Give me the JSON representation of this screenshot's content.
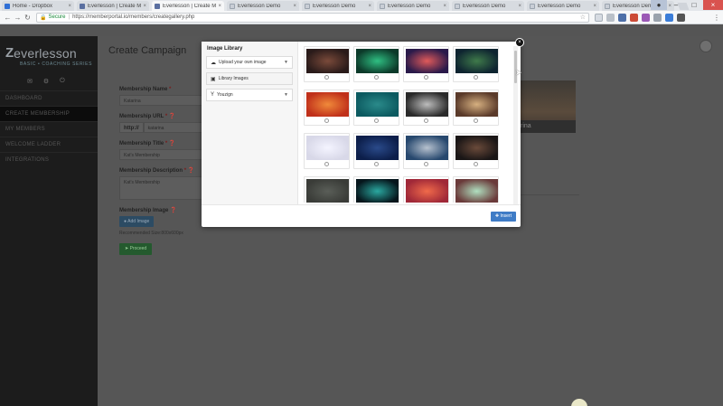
{
  "browser": {
    "tabs": [
      {
        "title": "Home - Dropbox",
        "icon": "dropbox-icon",
        "active": false
      },
      {
        "title": "Everlesson | Create Me",
        "icon": "everlesson-icon",
        "active": false
      },
      {
        "title": "Everlesson | Create M",
        "icon": "everlesson-icon",
        "active": true
      },
      {
        "title": "Everlesson Demo",
        "icon": "page-icon",
        "active": false
      },
      {
        "title": "Everlesson Demo",
        "icon": "page-icon",
        "active": false
      },
      {
        "title": "Everlesson Demo",
        "icon": "page-icon",
        "active": false
      },
      {
        "title": "Everlesson Demo",
        "icon": "page-icon",
        "active": false
      },
      {
        "title": "Everlesson Demo",
        "icon": "page-icon",
        "active": false
      },
      {
        "title": "Everlesson Demo",
        "icon": "page-icon",
        "active": false
      }
    ],
    "secure_label": "Secure",
    "url": "https://memberportal.io/members/creategallery.php"
  },
  "app": {
    "logo_word": "everlesson",
    "logo_tag": "BASIC • COACHING SERIES",
    "sidebar_items": [
      "Dashboard",
      "Create Membership",
      "My Members",
      "Welcome Ladder",
      "Integrations"
    ],
    "page_title": "Create Campaign",
    "form": {
      "name_label": "Membership Name",
      "name_value": "Katarina",
      "url_label": "Membership URL",
      "url_prefix": "http://",
      "url_value": "katarina",
      "title_label": "Membership Title",
      "title_value": "Kat's Membership",
      "desc_label": "Membership Description",
      "desc_value": "Kat's Membership",
      "image_label": "Membership Image",
      "add_image_label": "Add Image",
      "hint": "Recommended Size:800x600px",
      "proceed_label": "Proceed"
    },
    "preview_caption": "rina"
  },
  "modal": {
    "title": "Image Library",
    "upload_label": "Upload your own image",
    "library_label": "Library Images",
    "filter_label": "Youzign",
    "insert_label": "Insert",
    "thumb_colors": [
      [
        "#2a1b1a",
        "#7a4a3a"
      ],
      [
        "#0c3a2a",
        "#2fbf82"
      ],
      [
        "#2a1a4a",
        "#e05a5a"
      ],
      [
        "#0e2430",
        "#3f7a4a"
      ],
      [
        "#c0301a",
        "#f08a3a"
      ],
      [
        "#0c5a60",
        "#2a8a8a"
      ],
      [
        "#2a2a2a",
        "#bdbdbd"
      ],
      [
        "#5a3a2a",
        "#d6b080"
      ],
      [
        "#d8d8e8",
        "#f4f4ff"
      ],
      [
        "#0c1e4a",
        "#2a4a8a"
      ],
      [
        "#27486e",
        "#b7c2cf"
      ],
      [
        "#1a1616",
        "#6a4a3a"
      ],
      [
        "#3a3c38",
        "#5a5e58"
      ],
      [
        "#06161c",
        "#2aa8a0"
      ],
      [
        "#a02838",
        "#f06a4a"
      ],
      [
        "#6a3a3a",
        "#b0e0c0"
      ]
    ]
  }
}
